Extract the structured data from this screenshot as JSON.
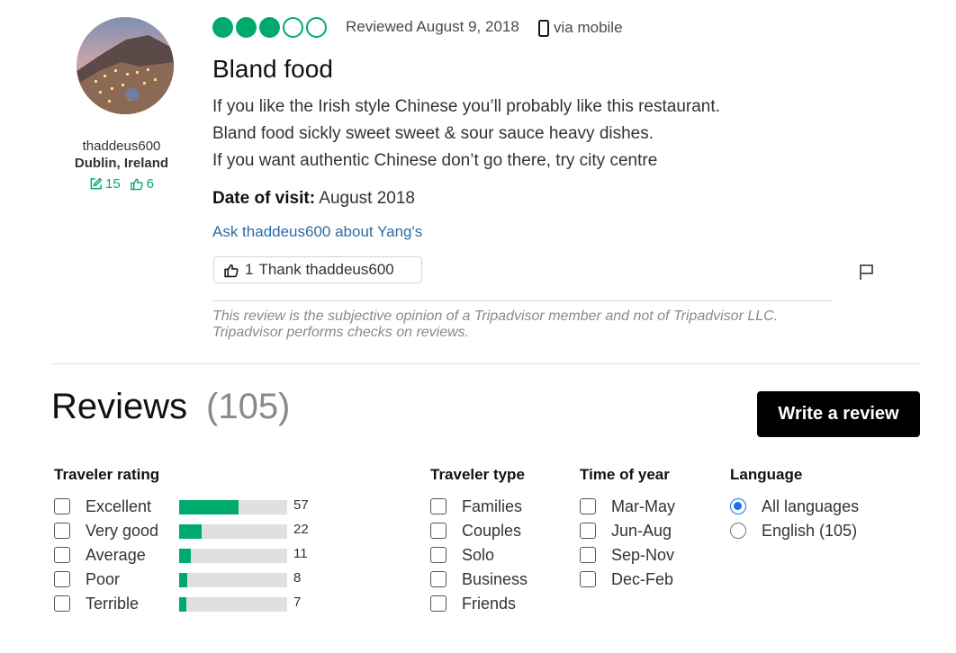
{
  "review": {
    "user": {
      "name": "thaddeus600",
      "hometown": "Dublin, Ireland",
      "contributions": "15",
      "helpful_votes": "6"
    },
    "rating": 3,
    "rating_max": 5,
    "reviewed_date": "Reviewed August 9, 2018",
    "via": "via mobile",
    "title": "Bland food",
    "body_lines": [
      "If you like the Irish style Chinese you’ll probably like this restaurant.",
      "Bland food sickly sweet sweet & sour sauce heavy dishes.",
      "If you want authentic Chinese don’t go there, try city centre"
    ],
    "date_of_visit_label": "Date of visit:",
    "date_of_visit": "August 2018",
    "ask_link": "Ask thaddeus600 about Yang's",
    "thank_count": "1",
    "thank_label": "Thank thaddeus600",
    "disclaimer": "This review is the subjective opinion of a Tripadvisor member and not of Tripadvisor LLC. Tripadvisor performs checks on reviews."
  },
  "reviews_section": {
    "heading": "Reviews",
    "count": "(105)",
    "write_button": "Write a review"
  },
  "filters": {
    "traveler_rating": {
      "title": "Traveler rating",
      "max": 57,
      "items": [
        {
          "label": "Excellent",
          "count": 57
        },
        {
          "label": "Very good",
          "count": 22
        },
        {
          "label": "Average",
          "count": 11
        },
        {
          "label": "Poor",
          "count": 8
        },
        {
          "label": "Terrible",
          "count": 7
        }
      ]
    },
    "traveler_type": {
      "title": "Traveler type",
      "items": [
        "Families",
        "Couples",
        "Solo",
        "Business",
        "Friends"
      ]
    },
    "time_of_year": {
      "title": "Time of year",
      "items": [
        "Mar-May",
        "Jun-Aug",
        "Sep-Nov",
        "Dec-Feb"
      ]
    },
    "language": {
      "title": "Language",
      "items": [
        {
          "label": "All languages",
          "selected": true
        },
        {
          "label": "English (105)",
          "selected": false
        }
      ]
    }
  },
  "colors": {
    "accent": "#00aa6c",
    "link": "#2e6da4",
    "radio": "#1a73e8"
  }
}
